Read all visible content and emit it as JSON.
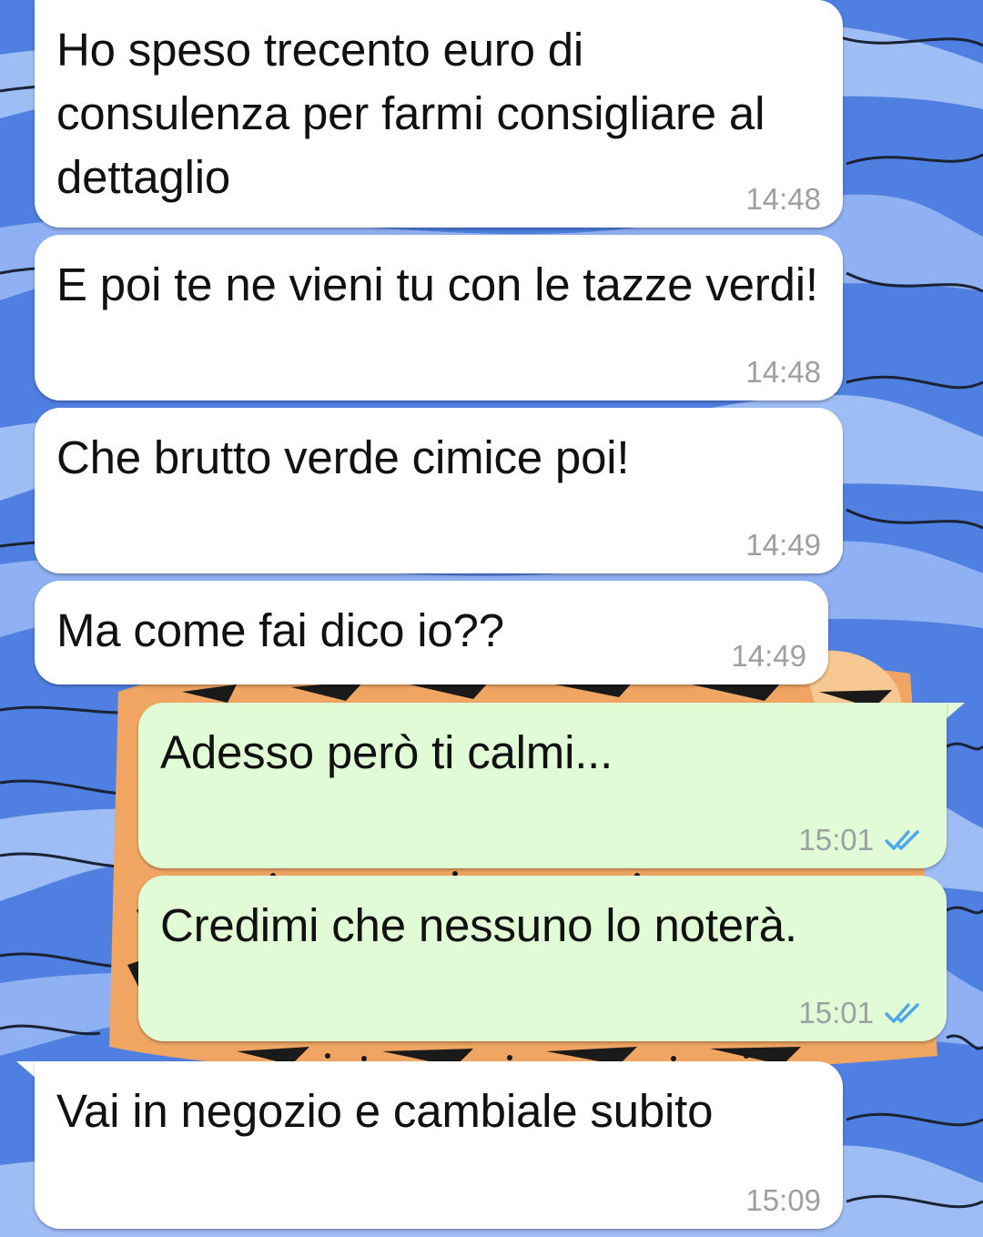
{
  "chat": {
    "background_color": "#4f7fe0",
    "incoming_bubble_color": "#ffffff",
    "outgoing_bubble_color": "#e1fbd6",
    "read_receipt_color": "#4fa8e8",
    "messages": [
      {
        "direction": "incoming",
        "text": "Ho speso trecento euro di consulenza per farmi consigliare al dettaglio",
        "time": "14:48",
        "status": ""
      },
      {
        "direction": "incoming",
        "text": "E poi te ne vieni tu con le tazze verdi!",
        "time": "14:48",
        "status": ""
      },
      {
        "direction": "incoming",
        "text": "Che brutto verde cimice poi!",
        "time": "14:49",
        "status": ""
      },
      {
        "direction": "incoming",
        "text": "Ma come fai dico io??",
        "time": "14:49",
        "status": ""
      },
      {
        "direction": "outgoing",
        "text": "Adesso però ti calmi...",
        "time": "15:01",
        "status": "read"
      },
      {
        "direction": "outgoing",
        "text": "Credimi che nessuno lo noterà.",
        "time": "15:01",
        "status": "read"
      },
      {
        "direction": "incoming",
        "text": "Vai in negozio e cambiale subito",
        "time": "15:09",
        "status": ""
      }
    ]
  }
}
